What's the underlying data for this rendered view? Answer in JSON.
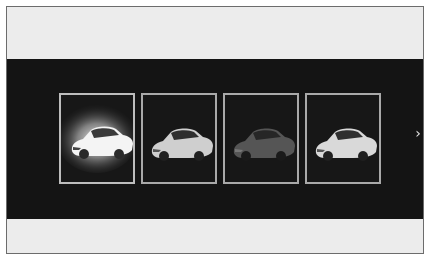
{
  "carousel": {
    "items": [
      {
        "id": "car-white-selected",
        "color": "#f4f4f4",
        "selected": true
      },
      {
        "id": "car-silver",
        "color": "#cfcfcf",
        "selected": false
      },
      {
        "id": "car-dark-gray",
        "color": "#555555",
        "selected": false
      },
      {
        "id": "car-pearl",
        "color": "#d9d9d9",
        "selected": false
      }
    ],
    "next_icon": "chevron-right-icon",
    "next_glyph": "›"
  }
}
